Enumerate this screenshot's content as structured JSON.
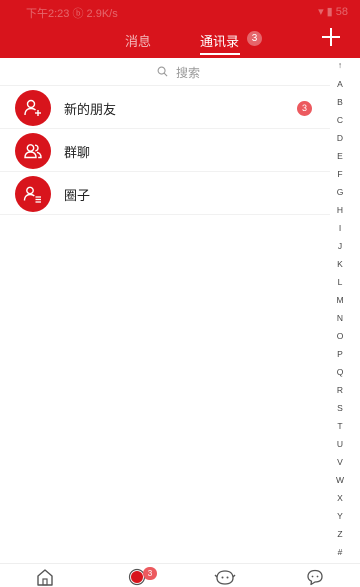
{
  "status_bar": {
    "left_text": "下午2:23 ⓑ 2.9K/s",
    "right_text": "▾ ▮ 58"
  },
  "tabs": [
    {
      "label": "消息",
      "active": false
    },
    {
      "label": "通讯录",
      "active": true,
      "badge": "3"
    }
  ],
  "header_icons": {
    "add": "plus-icon"
  },
  "search": {
    "placeholder": "搜索"
  },
  "contacts_menu": [
    {
      "label": "新的朋友",
      "icon": "add-friend-icon",
      "badge": "3"
    },
    {
      "label": "群聊",
      "icon": "group-chat-icon"
    },
    {
      "label": "圈子",
      "icon": "circle-icon"
    }
  ],
  "alphabet_index": [
    "↑",
    "A",
    "B",
    "C",
    "D",
    "E",
    "F",
    "G",
    "H",
    "I",
    "J",
    "K",
    "L",
    "M",
    "N",
    "O",
    "P",
    "Q",
    "R",
    "S",
    "T",
    "U",
    "V",
    "W",
    "X",
    "Y",
    "Z",
    "#"
  ],
  "bottom_nav": [
    {
      "icon": "home-icon"
    },
    {
      "icon": "message-icon",
      "badge": "3"
    },
    {
      "icon": "discover-icon"
    },
    {
      "icon": "me-icon"
    }
  ],
  "colors": {
    "accent": "#d8141c",
    "badge": "#ec5a5f"
  }
}
